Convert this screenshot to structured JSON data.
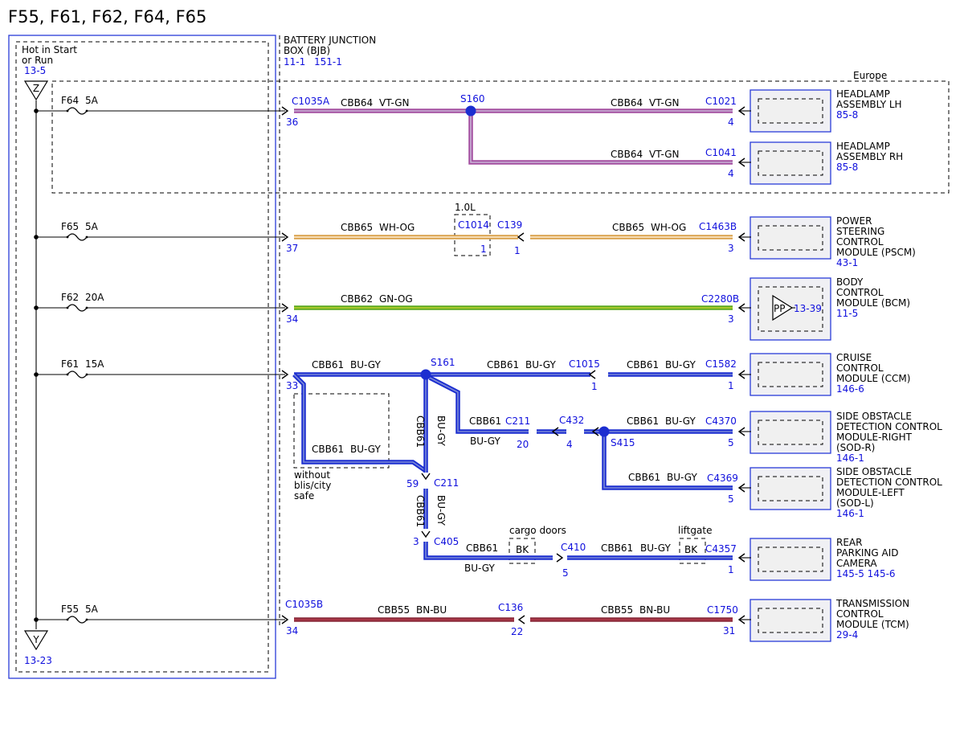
{
  "title": "F55, F61, F62, F64, F65",
  "colors": {
    "VT-GN": [
      "#a34fa0",
      "#c9b5d8"
    ],
    "WH-OG": [
      "#d9a04a",
      "#fff0d8"
    ],
    "GN-OG": [
      "#5aa81e",
      "#c2d230"
    ],
    "BU-GY": [
      "#1c2ed0",
      "#7c8ad8"
    ],
    "BN-BU": [
      "#8a2a3a",
      "#b23a4a"
    ]
  },
  "fuse_panel": {
    "hot_label_line1": "Hot in Start",
    "hot_label_line2": "or Run",
    "hot_ref": "13-5",
    "top_terminal": "Z",
    "bottom_terminal": "Y",
    "bottom_ref": "13-23"
  },
  "bjb": {
    "line1": "BATTERY JUNCTION",
    "line2": "BOX (BJB)",
    "ref1": "11-1",
    "ref2": "151-1"
  },
  "europe_label": "Europe",
  "fuses": [
    {
      "name": "F64",
      "rating": "5A"
    },
    {
      "name": "F65",
      "rating": "5A"
    },
    {
      "name": "F62",
      "rating": "20A"
    },
    {
      "name": "F61",
      "rating": "15A"
    },
    {
      "name": "F55",
      "rating": "5A"
    }
  ],
  "labels": [
    {
      "text": "C1035A",
      "ref": true
    },
    {
      "text": "36",
      "ref": true
    },
    {
      "text": "CBB64",
      "ref": false
    },
    {
      "text": "VT-GN",
      "ref": false
    },
    {
      "text": "S160",
      "ref": true
    },
    {
      "text": "CBB64",
      "ref": false
    },
    {
      "text": "VT-GN",
      "ref": false
    },
    {
      "text": "C1021",
      "ref": true
    },
    {
      "text": "4",
      "ref": true
    },
    {
      "text": "CBB64",
      "ref": false
    },
    {
      "text": "VT-GN",
      "ref": false
    },
    {
      "text": "C1041",
      "ref": true
    },
    {
      "text": "4",
      "ref": true
    },
    {
      "text": "1.0L",
      "ref": false
    },
    {
      "text": "C1014",
      "ref": true
    },
    {
      "text": "1",
      "ref": true
    },
    {
      "text": "C139",
      "ref": true
    },
    {
      "text": "1",
      "ref": true
    },
    {
      "text": "CBB65",
      "ref": false
    },
    {
      "text": "WH-OG",
      "ref": false
    },
    {
      "text": "37",
      "ref": true
    },
    {
      "text": "CBB65",
      "ref": false
    },
    {
      "text": "WH-OG",
      "ref": false
    },
    {
      "text": "C1463B",
      "ref": true
    },
    {
      "text": "3",
      "ref": true
    },
    {
      "text": "CBB62",
      "ref": false
    },
    {
      "text": "GN-OG",
      "ref": false
    },
    {
      "text": "34",
      "ref": true
    },
    {
      "text": "C2280B",
      "ref": true
    },
    {
      "text": "3",
      "ref": true
    },
    {
      "text": "CBB61",
      "ref": false
    },
    {
      "text": "BU-GY",
      "ref": false
    },
    {
      "text": "33",
      "ref": true
    },
    {
      "text": "S161",
      "ref": true
    },
    {
      "text": "CBB61",
      "ref": false
    },
    {
      "text": "BU-GY",
      "ref": false
    },
    {
      "text": "C1015",
      "ref": true
    },
    {
      "text": "1",
      "ref": true
    },
    {
      "text": "CBB61",
      "ref": false
    },
    {
      "text": "BU-GY",
      "ref": false
    },
    {
      "text": "C1582",
      "ref": true
    },
    {
      "text": "1",
      "ref": true
    },
    {
      "text": "CBB61",
      "ref": false
    },
    {
      "text": "C211",
      "ref": true
    },
    {
      "text": "BU-GY",
      "ref": false
    },
    {
      "text": "20",
      "ref": true
    },
    {
      "text": "C432",
      "ref": true
    },
    {
      "text": "4",
      "ref": true
    },
    {
      "text": "S415",
      "ref": true
    },
    {
      "text": "CBB61",
      "ref": false
    },
    {
      "text": "BU-GY",
      "ref": false
    },
    {
      "text": "C4370",
      "ref": true
    },
    {
      "text": "5",
      "ref": true
    },
    {
      "text": "CBB61",
      "ref": false
    },
    {
      "text": "BU-GY",
      "ref": false
    },
    {
      "text": "C4369",
      "ref": true
    },
    {
      "text": "5",
      "ref": true
    },
    {
      "text": "CBB61",
      "ref": false
    },
    {
      "text": "BU-GY",
      "ref": false
    },
    {
      "text": "without",
      "ref": false
    },
    {
      "text": "blis/city",
      "ref": false
    },
    {
      "text": "safe",
      "ref": false
    },
    {
      "text": "59",
      "ref": true
    },
    {
      "text": "C211",
      "ref": true
    },
    {
      "text": "3",
      "ref": true
    },
    {
      "text": "C405",
      "ref": true
    },
    {
      "text": "CBB61",
      "ref": false
    },
    {
      "text": "BU-GY",
      "ref": false
    },
    {
      "text": "cargo doors",
      "ref": false
    },
    {
      "text": "BK",
      "ref": false
    },
    {
      "text": "C410",
      "ref": true
    },
    {
      "text": "5",
      "ref": true
    },
    {
      "text": "CBB61",
      "ref": false
    },
    {
      "text": "BU-GY",
      "ref": false
    },
    {
      "text": "liftgate",
      "ref": false
    },
    {
      "text": "BK",
      "ref": false
    },
    {
      "text": "C4357",
      "ref": true
    },
    {
      "text": "1",
      "ref": true
    },
    {
      "text": "C1035B",
      "ref": true
    },
    {
      "text": "34",
      "ref": true
    },
    {
      "text": "CBB55",
      "ref": false
    },
    {
      "text": "BN-BU",
      "ref": false
    },
    {
      "text": "C136",
      "ref": true
    },
    {
      "text": "22",
      "ref": true
    },
    {
      "text": "CBB55",
      "ref": false
    },
    {
      "text": "BN-BU",
      "ref": false
    },
    {
      "text": "C1750",
      "ref": true
    },
    {
      "text": "31",
      "ref": true
    },
    {
      "text": "PP",
      "ref": false
    },
    {
      "text": "13-39",
      "ref": true
    }
  ],
  "vertical_labels": [
    {
      "text": "CBB61",
      "ref": false
    },
    {
      "text": "BU-GY",
      "ref": false
    },
    {
      "text": "CBB61",
      "ref": false
    },
    {
      "text": "BU-GY",
      "ref": false
    }
  ],
  "modules": [
    {
      "lines": [
        "HEADLAMP",
        "ASSEMBLY LH"
      ],
      "refs": "85-8"
    },
    {
      "lines": [
        "HEADLAMP",
        "ASSEMBLY RH"
      ],
      "refs": "85-8"
    },
    {
      "lines": [
        "POWER",
        "STEERING",
        "CONTROL",
        "MODULE (PSCM)"
      ],
      "refs": "43-1"
    },
    {
      "lines": [
        "BODY",
        "CONTROL",
        "MODULE (BCM)"
      ],
      "refs": "11-5"
    },
    {
      "lines": [
        "CRUISE",
        "CONTROL",
        "MODULE (CCM)"
      ],
      "refs": "146-6"
    },
    {
      "lines": [
        "SIDE OBSTACLE",
        "DETECTION CONTROL",
        "MODULE-RIGHT",
        "(SOD-R)"
      ],
      "refs": "146-1"
    },
    {
      "lines": [
        "SIDE OBSTACLE",
        "DETECTION CONTROL",
        "MODULE-LEFT",
        "(SOD-L)"
      ],
      "refs": "146-1"
    },
    {
      "lines": [
        "REAR",
        "PARKING AID",
        "CAMERA"
      ],
      "refs": "145-5   145-6"
    },
    {
      "lines": [
        "TRANSMISSION",
        "CONTROL",
        "MODULE (TCM)"
      ],
      "refs": "29-4"
    }
  ]
}
